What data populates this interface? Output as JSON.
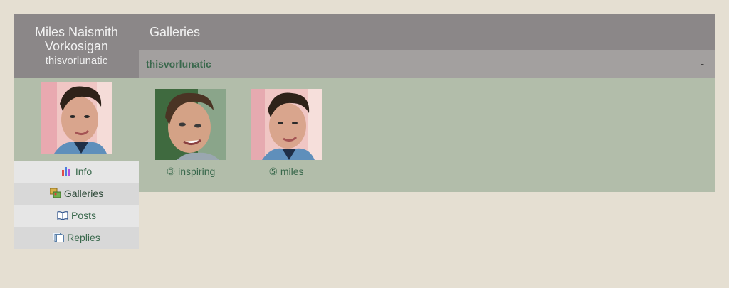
{
  "profile": {
    "name": "Miles Naismith Vorkosigan",
    "handle": "thisvorlunatic"
  },
  "nav": [
    {
      "label": "Info",
      "icon": "bar-chart-icon"
    },
    {
      "label": "Galleries",
      "icon": "galleries-icon"
    },
    {
      "label": "Posts",
      "icon": "book-icon"
    },
    {
      "label": "Replies",
      "icon": "pages-icon"
    }
  ],
  "main": {
    "title": "Galleries",
    "section_title": "thisvorlunatic",
    "collapse_label": "-",
    "galleries": [
      {
        "label": "③ inspiring"
      },
      {
        "label": "⑤ miles"
      }
    ]
  },
  "colors": {
    "background": "#e5dfd2",
    "header": "#8b8788",
    "subheader": "#a3a09f",
    "panel": "#b2bdaa",
    "link": "#39684c"
  }
}
